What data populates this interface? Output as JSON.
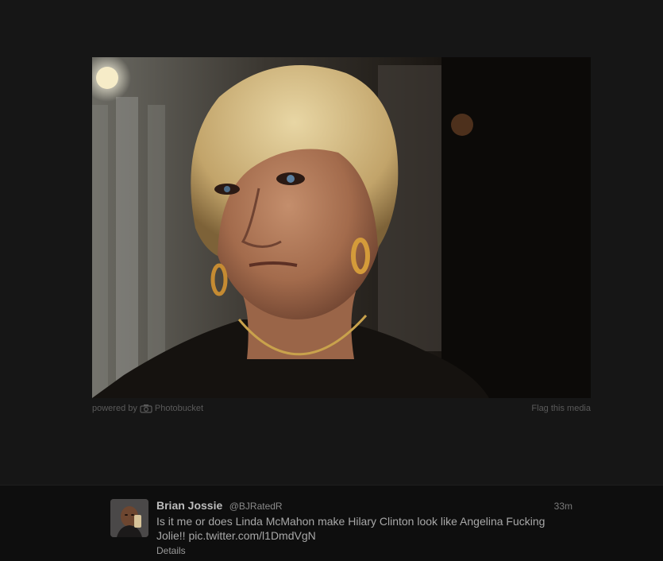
{
  "media": {
    "powered_by": "powered by",
    "provider": "Photobucket",
    "provider_icon": "camera-icon",
    "flag_label": "Flag this media"
  },
  "tweet": {
    "full_name": "Brian Jossie",
    "screen_name": "@BJRatedR",
    "timestamp": "33m",
    "text": "Is it me or does Linda McMahon make Hilary Clinton look like Angelina Fucking Jolie!! ",
    "link": "pic.twitter.com/l1DmdVgN",
    "details_label": "Details"
  },
  "colors": {
    "background": "#161616",
    "tweet_bar": "#0e0e0e",
    "name_text": "#bdbdbd",
    "body_text": "#a8a8a8"
  }
}
